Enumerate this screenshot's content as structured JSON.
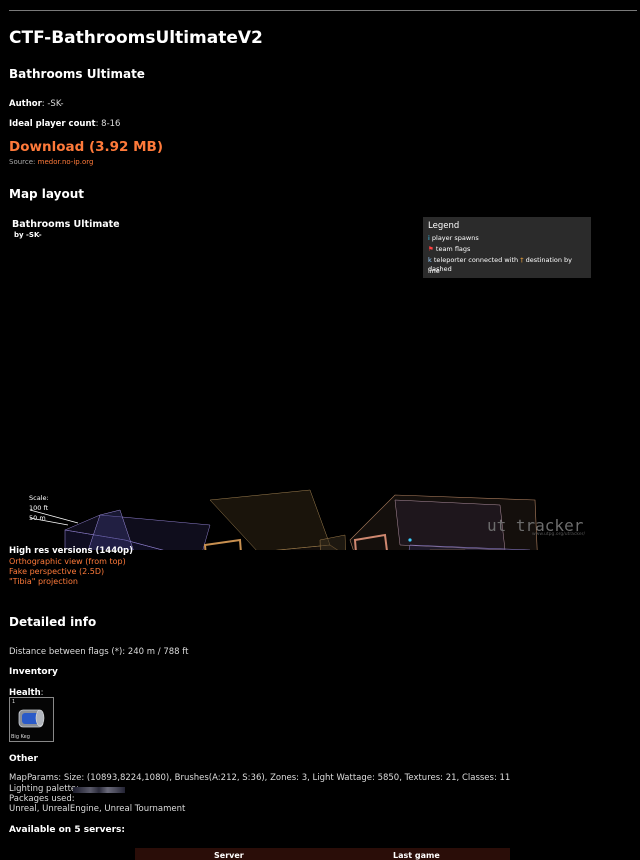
{
  "breadcrumb": "",
  "page_title": "CTF-BathroomsUltimateV2",
  "map_name": "Bathrooms Ultimate",
  "author_label": "Author",
  "author_value": "-SK-",
  "players_label": "Ideal player count",
  "players_value": "8-16",
  "download_label": "Download (3.92 MB)",
  "source_label": "Source:",
  "source_link": "medor.no-ip.org",
  "layout_heading": "Map layout",
  "map_image": {
    "title": "Bathrooms Ultimate",
    "by": "by -SK-",
    "legend": {
      "title": "Legend",
      "items": [
        "player spawns",
        "team flags",
        "teleporter connected with",
        "destination by dashed",
        "line"
      ]
    },
    "scale": {
      "label": "Scale:",
      "ft": "100 ft",
      "m": "50 m"
    },
    "watermark": "ut tracker",
    "watermark_sub": "www.utpg.org/utracker/"
  },
  "hires": {
    "heading": "High res versions (1440p)",
    "links": [
      "Orthographic view (from top)",
      "Fake perspective (2.5D)",
      "\"Tibia\" projection"
    ]
  },
  "detailed_heading": "Detailed info",
  "distance_text": "Distance between flags (*): 240 m / 788 ft",
  "inventory_heading": "Inventory",
  "health_label": "Health",
  "item": {
    "count": "1",
    "name": "Big Keg"
  },
  "other_heading": "Other",
  "mapparams_text": "MapParams: Size: (10893,8224,1080), Brushes(A:212, S:36), Zones: 3, Light Wattage: 5850, Textures: 21, Classes: 11",
  "palette_label": "Lighting palette:",
  "packages_label": "Packages used:",
  "packages_value": "Unreal, UnrealEngine, Unreal Tournament",
  "servers_heading": "Available on 5 servers:",
  "table_headers": [
    "Server",
    "Last game"
  ],
  "colors": {
    "accent": "#ff7a3a",
    "legend_bg": "#2b2b2b",
    "table_head_bg": "#2a0d08"
  }
}
